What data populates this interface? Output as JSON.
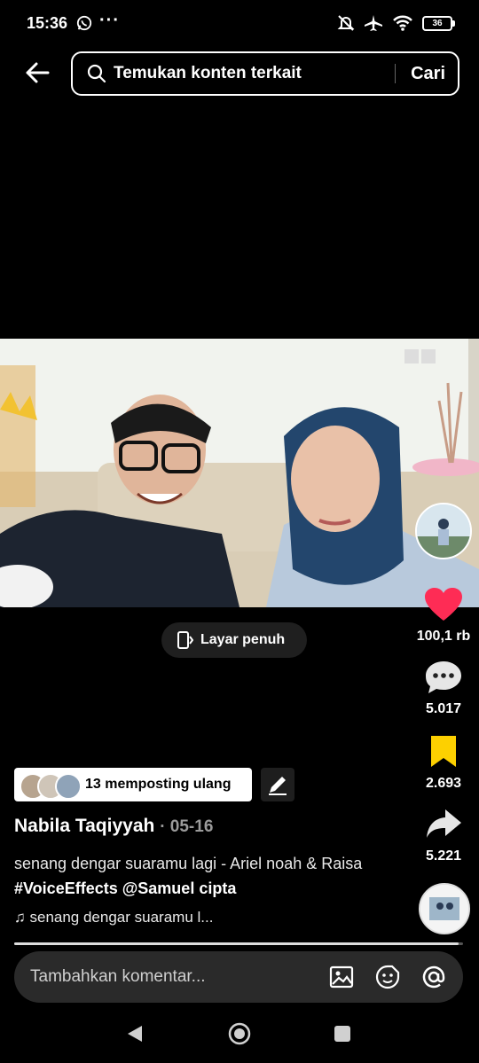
{
  "status_bar": {
    "time": "15:36",
    "battery": "36"
  },
  "search": {
    "placeholder": "Temukan konten terkait",
    "button": "Cari"
  },
  "fullscreen": {
    "label": "Layar penuh"
  },
  "actions": {
    "likes": "100,1 rb",
    "comments": "5.017",
    "bookmarks": "2.693",
    "shares": "5.221"
  },
  "repost": {
    "label": "13 memposting ulang"
  },
  "post": {
    "author": "Nabila Taqiyyah",
    "date": "· 05-16",
    "caption_text": "senang dengar suaramu lagi - Ariel noah & Raisa",
    "hashtag": "#VoiceEffects",
    "mention": "@Samuel cipta",
    "music": "senang dengar suaramu l..."
  },
  "progress": {
    "value": 0.99
  },
  "comment_bar": {
    "placeholder": "Tambahkan komentar..."
  },
  "colors": {
    "like": "#fe2c55",
    "bookmark": "#fdd000",
    "background": "#000000"
  },
  "icons": [
    "back-arrow-icon",
    "search-icon",
    "fullscreen-icon",
    "heart-icon",
    "comment-icon",
    "bookmark-icon",
    "share-icon",
    "edit-icon",
    "music-note-icon",
    "image-icon",
    "emoji-icon",
    "mention-icon",
    "nav-back-icon",
    "nav-home-icon",
    "nav-recents-icon"
  ]
}
